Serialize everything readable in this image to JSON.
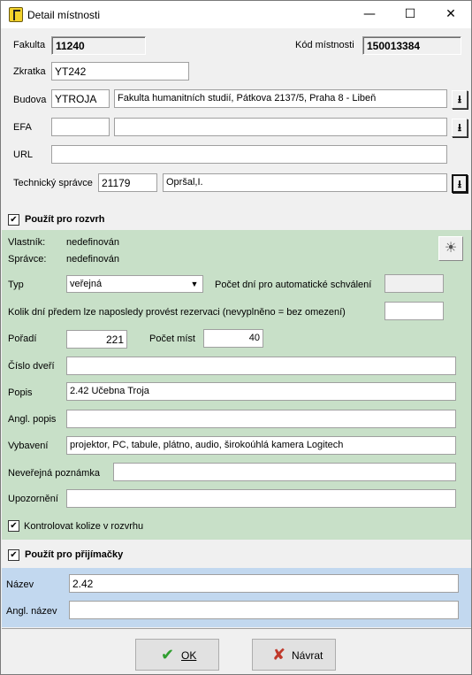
{
  "window": {
    "title": "Detail místnosti",
    "minimize": "—",
    "maximize": "☐",
    "close": "✕"
  },
  "top": {
    "fakulta_label": "Fakulta",
    "fakulta_value": "11240",
    "kod_label": "Kód místnosti",
    "kod_value": "150013384",
    "zkratka_label": "Zkratka",
    "zkratka_value": "YT242",
    "budova_label": "Budova",
    "budova_code": "YTROJA",
    "budova_name": "Fakulta humanitních studií, Pátkova 2137/5, Praha 8 - Libeň",
    "efa_label": "EFA",
    "efa_code": "",
    "efa_name": "",
    "url_label": "URL",
    "url_value": "",
    "tech_label": "Technický správce",
    "tech_code": "21179",
    "tech_name": "Opršal,I."
  },
  "rozvrh": {
    "use_label": "Použít pro rozvrh",
    "use_checked": "✔",
    "vlastnik_label": "Vlastník:",
    "vlastnik_value": "nedefinován",
    "spravce_label": "Správce:",
    "spravce_value": "nedefinován",
    "typ_label": "Typ",
    "typ_value": "veřejná",
    "auto_label": "Počet dní pro automatické schválení",
    "auto_value": "",
    "rez_label": "Kolik dní předem lze naposledy provést rezervaci  (nevyplněno = bez omezení)",
    "rez_value": "",
    "poradi_label": "Pořadí",
    "poradi_value": "221",
    "mist_label": "Počet míst",
    "mist_value": "40",
    "dvere_label": "Číslo dveří",
    "dvere_value": "",
    "popis_label": "Popis",
    "popis_value": "2.42 Učebna Troja",
    "angl_popis_label": "Angl. popis",
    "angl_popis_value": "",
    "vybaveni_label": "Vybavení",
    "vybaveni_value": "projektor, PC, tabule, plátno, audio, širokoúhlá kamera Logitech",
    "poznamka_label": "Neveřejná poznámka",
    "poznamka_value": "",
    "upozorneni_label": "Upozornění",
    "upozorneni_value": "",
    "kolize_label": "Kontrolovat kolize v rozvrhu",
    "kolize_checked": "✔"
  },
  "prijimacky": {
    "use_label": "Použít pro přijímačky",
    "use_checked": "✔",
    "nazev_label": "Název",
    "nazev_value": "2.42",
    "angl_nazev_label": "Angl. název",
    "angl_nazev_value": ""
  },
  "buttons": {
    "ok_label": "OK",
    "navrat_label": "Návrat"
  }
}
